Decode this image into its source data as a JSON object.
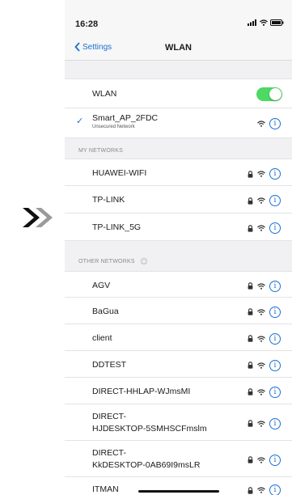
{
  "status": {
    "time": "16:28"
  },
  "nav": {
    "back_label": "Settings",
    "title": "WLAN"
  },
  "wlan_toggle": {
    "label": "WLAN",
    "on": true
  },
  "connected": {
    "name": "Smart_AP_2FDC",
    "subtitle": "Unsecured Network"
  },
  "my_networks": {
    "header": "MY NETWORKS",
    "items": [
      {
        "name": "HUAWEI-WIFI"
      },
      {
        "name": "TP-LINK"
      },
      {
        "name": "TP-LINK_5G"
      }
    ]
  },
  "other_networks": {
    "header": "OTHER NETWORKS",
    "items": [
      {
        "name": "AGV"
      },
      {
        "name": "BaGua"
      },
      {
        "name": "client"
      },
      {
        "name": "DDTEST"
      },
      {
        "name": "DIRECT-HHLAP-WJmsMI"
      },
      {
        "name": "DIRECT-",
        "name2": "HJDESKTOP-5SMHSCFmslm"
      },
      {
        "name": "DIRECT-",
        "name2": "KkDESKTOP-0AB69I9msLR"
      },
      {
        "name": "ITMAN"
      }
    ]
  },
  "colors": {
    "accent": "#1a6fd4",
    "toggle_on": "#4cd964",
    "arrow_dark": "#111111",
    "arrow_light": "#9a9a9a"
  },
  "icons": [
    "chevron-left-icon",
    "wifi-icon",
    "lock-icon",
    "info-icon",
    "checkmark-icon",
    "signal-icon",
    "battery-icon",
    "spinner-icon",
    "double-chevron-right-icon"
  ]
}
